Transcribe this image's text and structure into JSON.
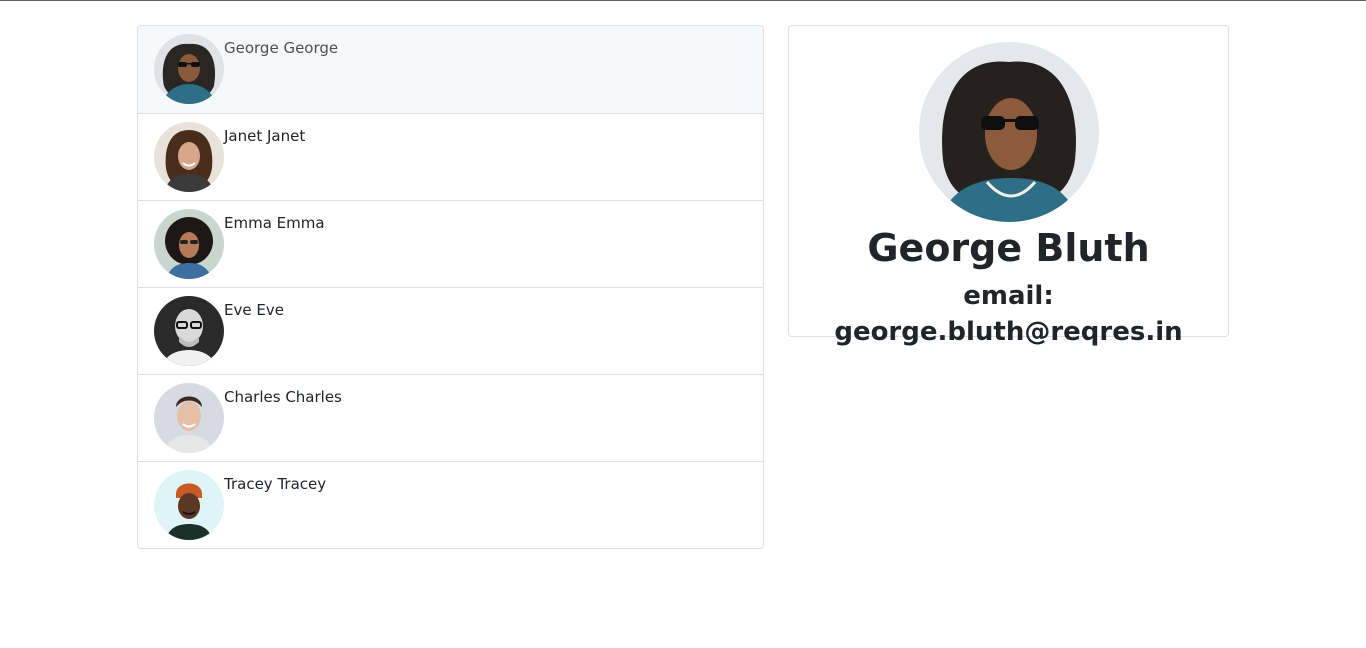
{
  "users": [
    {
      "name": "George George",
      "active": true
    },
    {
      "name": "Janet Janet",
      "active": false
    },
    {
      "name": "Emma Emma",
      "active": false
    },
    {
      "name": "Eve Eve",
      "active": false
    },
    {
      "name": "Charles Charles",
      "active": false
    },
    {
      "name": "Tracey Tracey",
      "active": false
    }
  ],
  "detail": {
    "name": "George Bluth",
    "email": "email: george.bluth@reqres.in"
  },
  "colors": {
    "border": "#dcdfe3",
    "active_row": "#f7f8fa",
    "text": "#212529"
  }
}
